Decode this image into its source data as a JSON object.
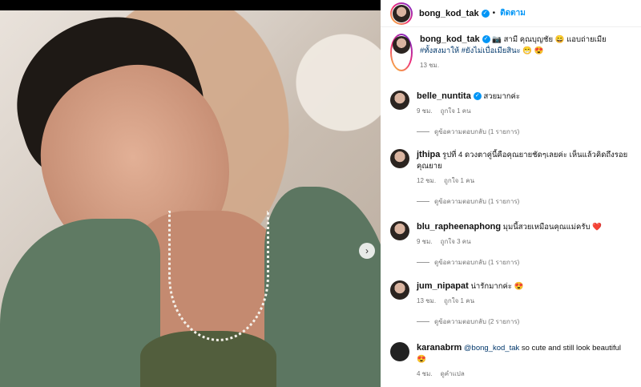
{
  "post": {
    "author": "bong_kod_tak",
    "follow_label": "ติดตาม",
    "dot": "•",
    "caption_prefix": "📷 สามี คุณบุญชัย 😄 แอบถ่ายเมีย",
    "caption_tags": "#ทั้งสงมาให้ #ยังไม่เบื่อเมียสินะ",
    "caption_suffix": "😁 😍",
    "time": "13 ชม."
  },
  "comments": [
    {
      "user": "belle_nuntita",
      "verified": true,
      "text": "สวยมากค่ะ",
      "time": "9 ชม.",
      "likes": "ถูกใจ 1 คน",
      "reply": "ดูข้อความตอบกลับ (1 รายการ)"
    },
    {
      "user": "jthipa",
      "verified": false,
      "text": "รูปที่ 4 ดวงตาคู่นี้คือคุณยายชัดๆเลยค่ะ เห็นแล้วคิดถึงรอย",
      "text2": "คุณยาย",
      "time": "12 ชม.",
      "likes": "ถูกใจ 1 คน",
      "reply": "ดูข้อความตอบกลับ (1 รายการ)"
    },
    {
      "user": "blu_rapheenaphong",
      "verified": false,
      "text": "มุมนี้สวยเหมือนคุณแม่ครับ ❤️",
      "time": "9 ชม.",
      "likes": "ถูกใจ 3 คน",
      "reply": "ดูข้อความตอบกลับ (1 รายการ)"
    },
    {
      "user": "jum_nipapat",
      "verified": false,
      "text": "น่ารักมากค่ะ 😍",
      "time": "13 ชม.",
      "likes": "ถูกใจ 1 คน",
      "reply": "ดูข้อความตอบกลับ (2 รายการ)"
    },
    {
      "user": "karanabrm",
      "verified": false,
      "mention": "@bong_kod_tak",
      "text": " so cute and still look beautiful",
      "text2": "😍",
      "time": "4 ชม.",
      "likes": "ดูคำแปล",
      "reply": ""
    }
  ],
  "icons": {
    "next": "chevron-right-icon",
    "verified": "verified-badge-icon"
  },
  "colors": {
    "accent": "#0095f6",
    "tag": "#00376b"
  }
}
